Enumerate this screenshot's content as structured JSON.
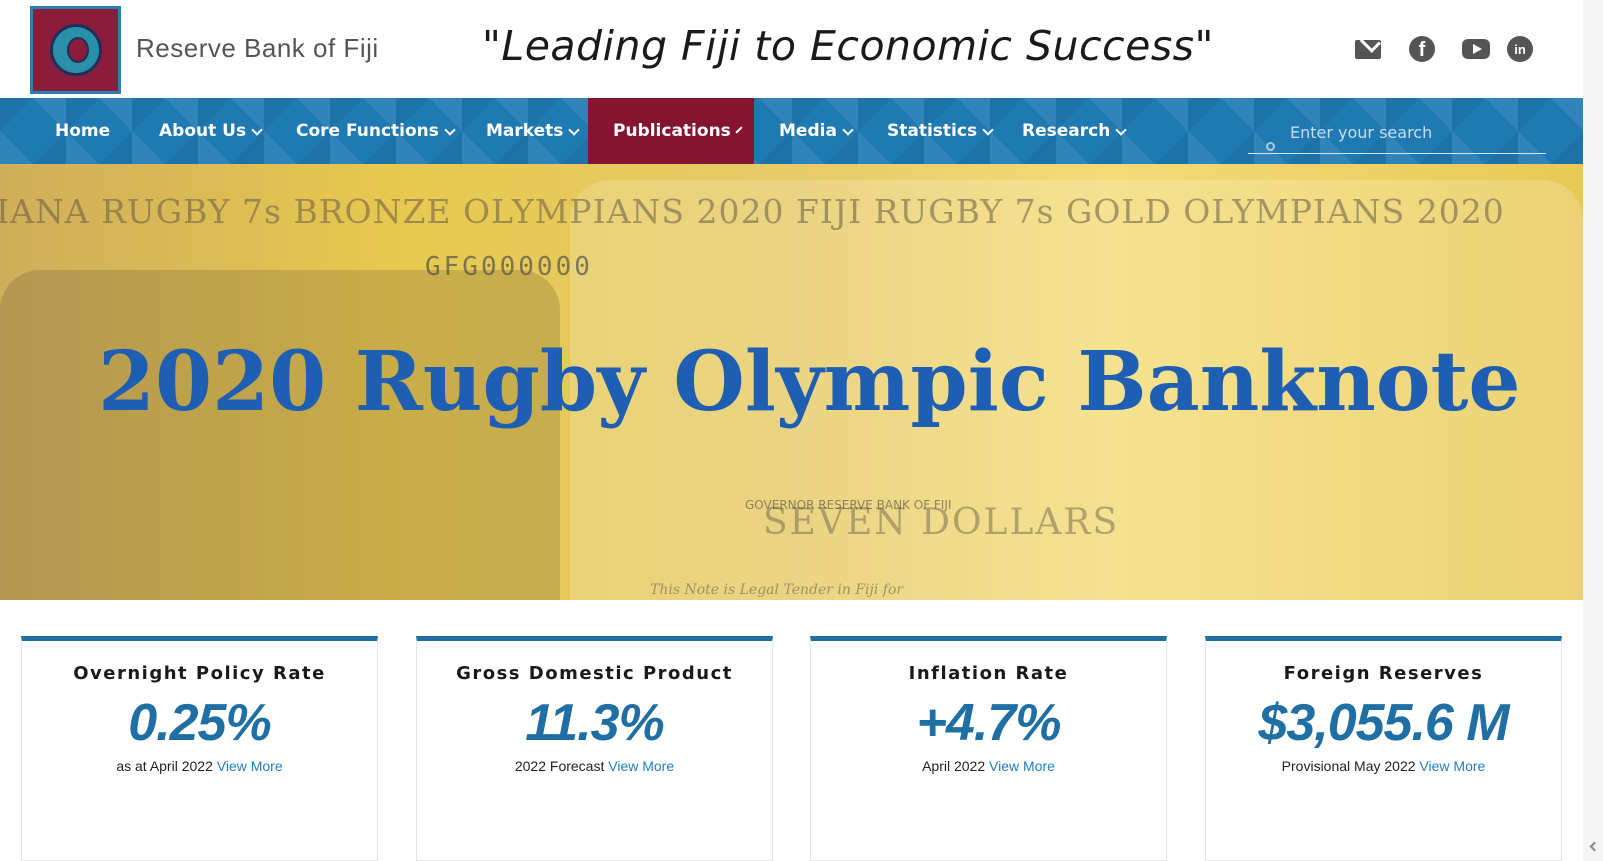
{
  "header": {
    "brand": "Reserve Bank of Fiji",
    "tagline": "\"Leading Fiji to Economic Success\"",
    "social": {
      "email_icon": "envelope-icon",
      "facebook_icon": "facebook-icon",
      "youtube_icon": "youtube-icon",
      "linkedin_icon": "linkedin-icon",
      "facebook_glyph": "f",
      "linkedin_glyph": "in"
    }
  },
  "nav": {
    "items": [
      {
        "label": "Home",
        "dropdown": false
      },
      {
        "label": "About Us",
        "dropdown": true
      },
      {
        "label": "Core Functions",
        "dropdown": true
      },
      {
        "label": "Markets",
        "dropdown": true
      },
      {
        "label": "Publications",
        "dropdown": true,
        "active": true
      },
      {
        "label": "Media",
        "dropdown": true
      },
      {
        "label": "Statistics",
        "dropdown": true
      },
      {
        "label": "Research",
        "dropdown": true
      }
    ],
    "search_placeholder": "Enter your search"
  },
  "hero": {
    "title": "2020 Rugby Olympic Banknote",
    "banner_line": "IANA RUGBY 7s BRONZE OLYMPIANS 2020   FIJI RUGBY 7s GOLD OLYMPIANS 2020",
    "serial": "GFG000000",
    "denomination": "SEVEN DOLLARS",
    "governor": "GOVERNOR RESERVE BANK OF FIJI",
    "tender": "This Note is Legal Tender in Fiji for"
  },
  "stats": [
    {
      "title": "Overnight Policy Rate",
      "value": "0.25%",
      "note": "as at April 2022",
      "link": "View More"
    },
    {
      "title": "Gross Domestic Product",
      "value": "11.3%",
      "note": "2022 Forecast",
      "link": "View More"
    },
    {
      "title": "Inflation Rate",
      "value": "+4.7%",
      "note": "April 2022",
      "link": "View More"
    },
    {
      "title": "Foreign Reserves",
      "value": "$3,055.6 M",
      "note": "Provisional May 2022",
      "link": "View More"
    }
  ],
  "colors": {
    "nav_bg": "#1f79b3",
    "nav_active": "#851431",
    "stat_value": "#1f6fa5",
    "hero_title": "#1f5fb3"
  }
}
